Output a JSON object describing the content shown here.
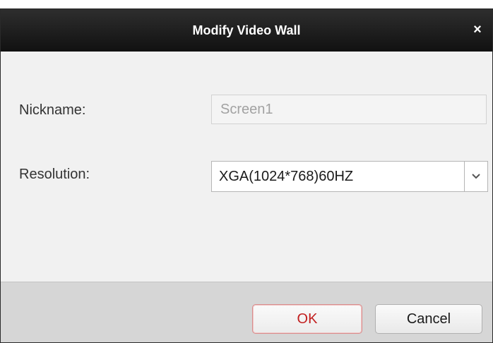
{
  "dialog": {
    "title": "Modify Video Wall",
    "close_symbol": "×"
  },
  "form": {
    "nickname": {
      "label": "Nickname:",
      "value": "Screen1"
    },
    "resolution": {
      "label": "Resolution:",
      "selected": "XGA(1024*768)60HZ"
    }
  },
  "buttons": {
    "ok": "OK",
    "cancel": "Cancel"
  },
  "icons": {
    "close": "close-icon",
    "dropdown": "chevron-down-icon"
  }
}
